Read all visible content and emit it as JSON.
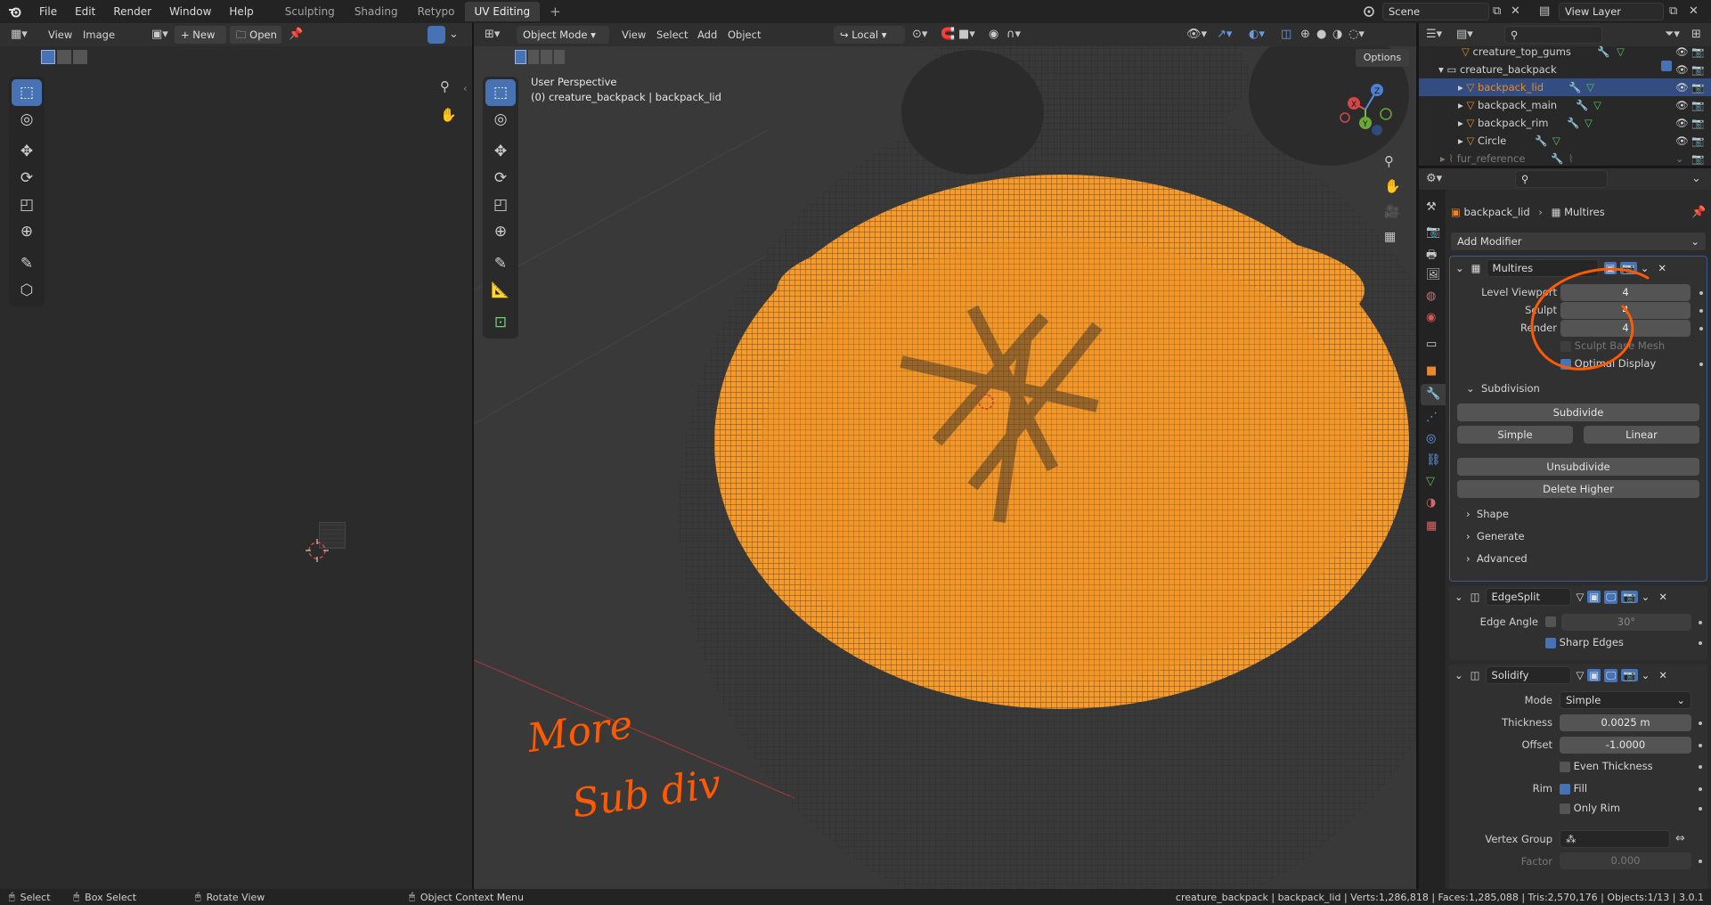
{
  "app": {
    "logo": "blender-logo-icon"
  },
  "menu": [
    "File",
    "Edit",
    "Render",
    "Window",
    "Help"
  ],
  "workspace_tabs": [
    {
      "label": "Sculpting"
    },
    {
      "label": "Shading"
    },
    {
      "label": "Retypo"
    },
    {
      "label": "UV Editing",
      "active": true
    }
  ],
  "add_workspace": "+",
  "scene": {
    "label": "Scene"
  },
  "view_layer": {
    "label": "View Layer"
  },
  "uv_editor": {
    "menus": [
      "View",
      "Image"
    ],
    "new_label": "New",
    "open_label": "Open"
  },
  "viewport": {
    "mode": "Object Mode",
    "menus": [
      "View",
      "Select",
      "Add",
      "Object"
    ],
    "orientation": "Local",
    "options_label": "Options",
    "info_line1": "User Perspective",
    "info_line2": "(0) creature_backpack | backpack_lid",
    "axis_x": "X",
    "axis_y": "Y",
    "axis_z": "Z"
  },
  "annotation": {
    "line1": "More",
    "line2": "Sub div"
  },
  "outliner": {
    "rows": [
      {
        "label": "creature_top_gums",
        "indent": 1
      },
      {
        "label": "creature_backpack",
        "indent": 0,
        "collection": true
      },
      {
        "label": "backpack_lid",
        "indent": 1,
        "selected": true
      },
      {
        "label": "backpack_main",
        "indent": 1
      },
      {
        "label": "backpack_rim",
        "indent": 1
      },
      {
        "label": "Circle",
        "indent": 1
      },
      {
        "label": "fur_reference",
        "indent": 0,
        "dim": true
      }
    ]
  },
  "properties": {
    "breadcrumb_object": "backpack_lid",
    "breadcrumb_sep": "›",
    "breadcrumb_modifier": "Multires",
    "add_modifier": "Add Modifier",
    "multires": {
      "name": "Multires",
      "level_viewport_label": "Level Viewport",
      "level_viewport": "4",
      "sculpt_label": "Sculpt",
      "sculpt": "4",
      "render_label": "Render",
      "render": "4",
      "sculpt_base_mesh": "Sculpt Base Mesh",
      "optimal_display": "Optimal Display",
      "subdivision_label": "Subdivision",
      "subdivide": "Subdivide",
      "simple": "Simple",
      "linear": "Linear",
      "unsubdivide": "Unsubdivide",
      "delete_higher": "Delete Higher",
      "shape": "Shape",
      "generate": "Generate",
      "advanced": "Advanced"
    },
    "edgesplit": {
      "name": "EdgeSplit",
      "edge_angle_label": "Edge Angle",
      "edge_angle": "30°",
      "sharp_edges": "Sharp Edges"
    },
    "solidify": {
      "name": "Solidify",
      "mode_label": "Mode",
      "mode": "Simple",
      "thickness_label": "Thickness",
      "thickness": "0.0025 m",
      "offset_label": "Offset",
      "offset": "-1.0000",
      "even_thickness": "Even Thickness",
      "rim_label": "Rim",
      "fill": "Fill",
      "only_rim": "Only Rim",
      "vertex_group_label": "Vertex Group",
      "factor_label": "Factor",
      "factor": "0.000"
    }
  },
  "statusbar": {
    "select": "Select",
    "box_select": "Box Select",
    "rotate_view": "Rotate View",
    "context_menu": "Object Context Menu",
    "stats": "creature_backpack | backpack_lid | Verts:1,286,818 | Faces:1,285,088 | Tris:2,570,176 | Objects:1/13 | 3.0.1"
  },
  "colors": {
    "accent": "#4772b3",
    "selection_orange": "#e8892e",
    "annotation": "#ff5a00",
    "bg": "#1d1d1d"
  }
}
